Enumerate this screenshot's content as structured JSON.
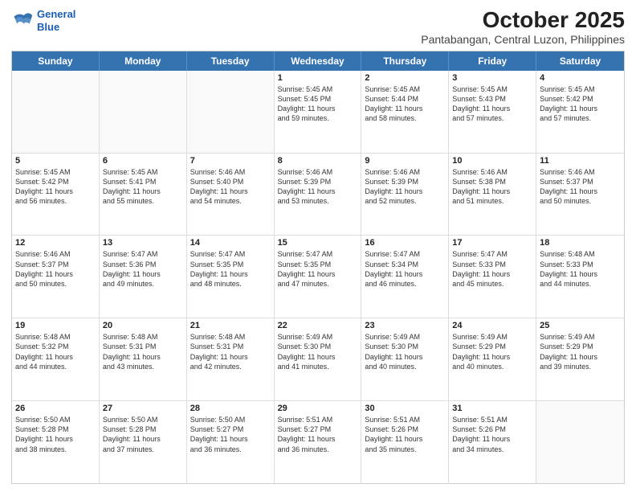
{
  "logo": {
    "line1": "General",
    "line2": "Blue"
  },
  "title": "October 2025",
  "subtitle": "Pantabangan, Central Luzon, Philippines",
  "days_of_week": [
    "Sunday",
    "Monday",
    "Tuesday",
    "Wednesday",
    "Thursday",
    "Friday",
    "Saturday"
  ],
  "weeks": [
    [
      {
        "day": "",
        "info": ""
      },
      {
        "day": "",
        "info": ""
      },
      {
        "day": "",
        "info": ""
      },
      {
        "day": "1",
        "info": "Sunrise: 5:45 AM\nSunset: 5:45 PM\nDaylight: 11 hours\nand 59 minutes."
      },
      {
        "day": "2",
        "info": "Sunrise: 5:45 AM\nSunset: 5:44 PM\nDaylight: 11 hours\nand 58 minutes."
      },
      {
        "day": "3",
        "info": "Sunrise: 5:45 AM\nSunset: 5:43 PM\nDaylight: 11 hours\nand 57 minutes."
      },
      {
        "day": "4",
        "info": "Sunrise: 5:45 AM\nSunset: 5:42 PM\nDaylight: 11 hours\nand 57 minutes."
      }
    ],
    [
      {
        "day": "5",
        "info": "Sunrise: 5:45 AM\nSunset: 5:42 PM\nDaylight: 11 hours\nand 56 minutes."
      },
      {
        "day": "6",
        "info": "Sunrise: 5:45 AM\nSunset: 5:41 PM\nDaylight: 11 hours\nand 55 minutes."
      },
      {
        "day": "7",
        "info": "Sunrise: 5:46 AM\nSunset: 5:40 PM\nDaylight: 11 hours\nand 54 minutes."
      },
      {
        "day": "8",
        "info": "Sunrise: 5:46 AM\nSunset: 5:39 PM\nDaylight: 11 hours\nand 53 minutes."
      },
      {
        "day": "9",
        "info": "Sunrise: 5:46 AM\nSunset: 5:39 PM\nDaylight: 11 hours\nand 52 minutes."
      },
      {
        "day": "10",
        "info": "Sunrise: 5:46 AM\nSunset: 5:38 PM\nDaylight: 11 hours\nand 51 minutes."
      },
      {
        "day": "11",
        "info": "Sunrise: 5:46 AM\nSunset: 5:37 PM\nDaylight: 11 hours\nand 50 minutes."
      }
    ],
    [
      {
        "day": "12",
        "info": "Sunrise: 5:46 AM\nSunset: 5:37 PM\nDaylight: 11 hours\nand 50 minutes."
      },
      {
        "day": "13",
        "info": "Sunrise: 5:47 AM\nSunset: 5:36 PM\nDaylight: 11 hours\nand 49 minutes."
      },
      {
        "day": "14",
        "info": "Sunrise: 5:47 AM\nSunset: 5:35 PM\nDaylight: 11 hours\nand 48 minutes."
      },
      {
        "day": "15",
        "info": "Sunrise: 5:47 AM\nSunset: 5:35 PM\nDaylight: 11 hours\nand 47 minutes."
      },
      {
        "day": "16",
        "info": "Sunrise: 5:47 AM\nSunset: 5:34 PM\nDaylight: 11 hours\nand 46 minutes."
      },
      {
        "day": "17",
        "info": "Sunrise: 5:47 AM\nSunset: 5:33 PM\nDaylight: 11 hours\nand 45 minutes."
      },
      {
        "day": "18",
        "info": "Sunrise: 5:48 AM\nSunset: 5:33 PM\nDaylight: 11 hours\nand 44 minutes."
      }
    ],
    [
      {
        "day": "19",
        "info": "Sunrise: 5:48 AM\nSunset: 5:32 PM\nDaylight: 11 hours\nand 44 minutes."
      },
      {
        "day": "20",
        "info": "Sunrise: 5:48 AM\nSunset: 5:31 PM\nDaylight: 11 hours\nand 43 minutes."
      },
      {
        "day": "21",
        "info": "Sunrise: 5:48 AM\nSunset: 5:31 PM\nDaylight: 11 hours\nand 42 minutes."
      },
      {
        "day": "22",
        "info": "Sunrise: 5:49 AM\nSunset: 5:30 PM\nDaylight: 11 hours\nand 41 minutes."
      },
      {
        "day": "23",
        "info": "Sunrise: 5:49 AM\nSunset: 5:30 PM\nDaylight: 11 hours\nand 40 minutes."
      },
      {
        "day": "24",
        "info": "Sunrise: 5:49 AM\nSunset: 5:29 PM\nDaylight: 11 hours\nand 40 minutes."
      },
      {
        "day": "25",
        "info": "Sunrise: 5:49 AM\nSunset: 5:29 PM\nDaylight: 11 hours\nand 39 minutes."
      }
    ],
    [
      {
        "day": "26",
        "info": "Sunrise: 5:50 AM\nSunset: 5:28 PM\nDaylight: 11 hours\nand 38 minutes."
      },
      {
        "day": "27",
        "info": "Sunrise: 5:50 AM\nSunset: 5:28 PM\nDaylight: 11 hours\nand 37 minutes."
      },
      {
        "day": "28",
        "info": "Sunrise: 5:50 AM\nSunset: 5:27 PM\nDaylight: 11 hours\nand 36 minutes."
      },
      {
        "day": "29",
        "info": "Sunrise: 5:51 AM\nSunset: 5:27 PM\nDaylight: 11 hours\nand 36 minutes."
      },
      {
        "day": "30",
        "info": "Sunrise: 5:51 AM\nSunset: 5:26 PM\nDaylight: 11 hours\nand 35 minutes."
      },
      {
        "day": "31",
        "info": "Sunrise: 5:51 AM\nSunset: 5:26 PM\nDaylight: 11 hours\nand 34 minutes."
      },
      {
        "day": "",
        "info": ""
      }
    ]
  ]
}
